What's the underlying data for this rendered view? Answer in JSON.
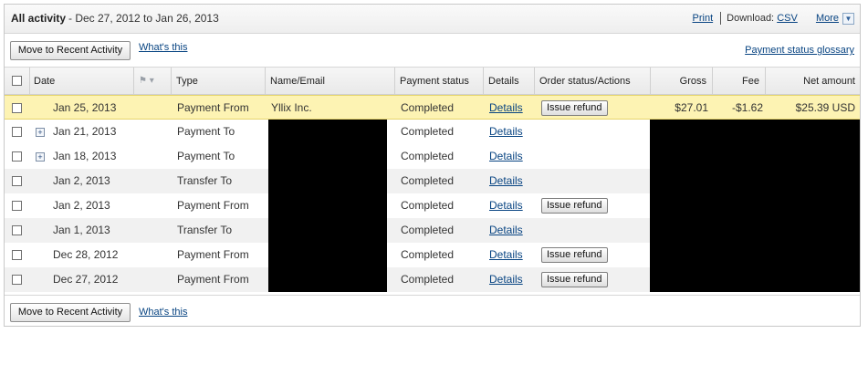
{
  "header": {
    "title": "All activity",
    "date_range": "- Dec 27, 2012 to Jan 26, 2013",
    "print": "Print",
    "download_label": "Download:",
    "csv": "CSV",
    "more": "More",
    "more_icon": "chevron-down-icon"
  },
  "actions": {
    "move_button": "Move to Recent Activity",
    "whats_this": "What's this",
    "glossary": "Payment status glossary"
  },
  "columns": {
    "date": "Date",
    "type": "Type",
    "name": "Name/Email",
    "status": "Payment status",
    "details": "Details",
    "order": "Order status/Actions",
    "gross": "Gross",
    "fee": "Fee",
    "net": "Net amount"
  },
  "rows": [
    {
      "date": "Jan 25, 2013",
      "type": "Payment From",
      "name": "Yllix Inc.",
      "status": "Completed",
      "details": "Details",
      "action": "Issue refund",
      "gross": "$27.01",
      "fee": "-$1.62",
      "net": "$25.39 USD"
    },
    {
      "date": "Jan 21, 2013",
      "type": "Payment To",
      "name": "",
      "status": "Completed",
      "details": "Details",
      "action": ""
    },
    {
      "date": "Jan 18, 2013",
      "type": "Payment To",
      "name": "",
      "status": "Completed",
      "details": "Details",
      "action": ""
    },
    {
      "date": "Jan 2, 2013",
      "type": "Transfer To",
      "name": "",
      "status": "Completed",
      "details": "Details",
      "action": ""
    },
    {
      "date": "Jan 2, 2013",
      "type": "Payment From",
      "name": "",
      "status": "Completed",
      "details": "Details",
      "action": "Issue refund"
    },
    {
      "date": "Jan 1, 2013",
      "type": "Transfer To",
      "name": "",
      "status": "Completed",
      "details": "Details",
      "action": ""
    },
    {
      "date": "Dec 28, 2012",
      "type": "Payment From",
      "name": "",
      "status": "Completed",
      "details": "Details",
      "action": "Issue refund"
    },
    {
      "date": "Dec 27, 2012",
      "type": "Payment From",
      "name": "",
      "status": "Completed",
      "details": "Details",
      "action": "Issue refund"
    }
  ],
  "colors": {
    "highlight_row": "#fdf3b3",
    "link": "#084482",
    "redaction": "#000000"
  }
}
